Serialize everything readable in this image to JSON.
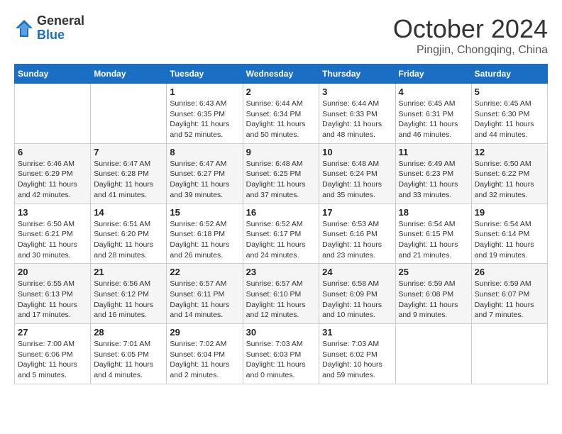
{
  "header": {
    "logo_general": "General",
    "logo_blue": "Blue",
    "month_title": "October 2024",
    "location": "Pingjin, Chongqing, China"
  },
  "weekdays": [
    "Sunday",
    "Monday",
    "Tuesday",
    "Wednesday",
    "Thursday",
    "Friday",
    "Saturday"
  ],
  "weeks": [
    [
      {
        "day": "",
        "info": ""
      },
      {
        "day": "",
        "info": ""
      },
      {
        "day": "1",
        "info": "Sunrise: 6:43 AM\nSunset: 6:35 PM\nDaylight: 11 hours and 52 minutes."
      },
      {
        "day": "2",
        "info": "Sunrise: 6:44 AM\nSunset: 6:34 PM\nDaylight: 11 hours and 50 minutes."
      },
      {
        "day": "3",
        "info": "Sunrise: 6:44 AM\nSunset: 6:33 PM\nDaylight: 11 hours and 48 minutes."
      },
      {
        "day": "4",
        "info": "Sunrise: 6:45 AM\nSunset: 6:31 PM\nDaylight: 11 hours and 46 minutes."
      },
      {
        "day": "5",
        "info": "Sunrise: 6:45 AM\nSunset: 6:30 PM\nDaylight: 11 hours and 44 minutes."
      }
    ],
    [
      {
        "day": "6",
        "info": "Sunrise: 6:46 AM\nSunset: 6:29 PM\nDaylight: 11 hours and 42 minutes."
      },
      {
        "day": "7",
        "info": "Sunrise: 6:47 AM\nSunset: 6:28 PM\nDaylight: 11 hours and 41 minutes."
      },
      {
        "day": "8",
        "info": "Sunrise: 6:47 AM\nSunset: 6:27 PM\nDaylight: 11 hours and 39 minutes."
      },
      {
        "day": "9",
        "info": "Sunrise: 6:48 AM\nSunset: 6:25 PM\nDaylight: 11 hours and 37 minutes."
      },
      {
        "day": "10",
        "info": "Sunrise: 6:48 AM\nSunset: 6:24 PM\nDaylight: 11 hours and 35 minutes."
      },
      {
        "day": "11",
        "info": "Sunrise: 6:49 AM\nSunset: 6:23 PM\nDaylight: 11 hours and 33 minutes."
      },
      {
        "day": "12",
        "info": "Sunrise: 6:50 AM\nSunset: 6:22 PM\nDaylight: 11 hours and 32 minutes."
      }
    ],
    [
      {
        "day": "13",
        "info": "Sunrise: 6:50 AM\nSunset: 6:21 PM\nDaylight: 11 hours and 30 minutes."
      },
      {
        "day": "14",
        "info": "Sunrise: 6:51 AM\nSunset: 6:20 PM\nDaylight: 11 hours and 28 minutes."
      },
      {
        "day": "15",
        "info": "Sunrise: 6:52 AM\nSunset: 6:18 PM\nDaylight: 11 hours and 26 minutes."
      },
      {
        "day": "16",
        "info": "Sunrise: 6:52 AM\nSunset: 6:17 PM\nDaylight: 11 hours and 24 minutes."
      },
      {
        "day": "17",
        "info": "Sunrise: 6:53 AM\nSunset: 6:16 PM\nDaylight: 11 hours and 23 minutes."
      },
      {
        "day": "18",
        "info": "Sunrise: 6:54 AM\nSunset: 6:15 PM\nDaylight: 11 hours and 21 minutes."
      },
      {
        "day": "19",
        "info": "Sunrise: 6:54 AM\nSunset: 6:14 PM\nDaylight: 11 hours and 19 minutes."
      }
    ],
    [
      {
        "day": "20",
        "info": "Sunrise: 6:55 AM\nSunset: 6:13 PM\nDaylight: 11 hours and 17 minutes."
      },
      {
        "day": "21",
        "info": "Sunrise: 6:56 AM\nSunset: 6:12 PM\nDaylight: 11 hours and 16 minutes."
      },
      {
        "day": "22",
        "info": "Sunrise: 6:57 AM\nSunset: 6:11 PM\nDaylight: 11 hours and 14 minutes."
      },
      {
        "day": "23",
        "info": "Sunrise: 6:57 AM\nSunset: 6:10 PM\nDaylight: 11 hours and 12 minutes."
      },
      {
        "day": "24",
        "info": "Sunrise: 6:58 AM\nSunset: 6:09 PM\nDaylight: 11 hours and 10 minutes."
      },
      {
        "day": "25",
        "info": "Sunrise: 6:59 AM\nSunset: 6:08 PM\nDaylight: 11 hours and 9 minutes."
      },
      {
        "day": "26",
        "info": "Sunrise: 6:59 AM\nSunset: 6:07 PM\nDaylight: 11 hours and 7 minutes."
      }
    ],
    [
      {
        "day": "27",
        "info": "Sunrise: 7:00 AM\nSunset: 6:06 PM\nDaylight: 11 hours and 5 minutes."
      },
      {
        "day": "28",
        "info": "Sunrise: 7:01 AM\nSunset: 6:05 PM\nDaylight: 11 hours and 4 minutes."
      },
      {
        "day": "29",
        "info": "Sunrise: 7:02 AM\nSunset: 6:04 PM\nDaylight: 11 hours and 2 minutes."
      },
      {
        "day": "30",
        "info": "Sunrise: 7:03 AM\nSunset: 6:03 PM\nDaylight: 11 hours and 0 minutes."
      },
      {
        "day": "31",
        "info": "Sunrise: 7:03 AM\nSunset: 6:02 PM\nDaylight: 10 hours and 59 minutes."
      },
      {
        "day": "",
        "info": ""
      },
      {
        "day": "",
        "info": ""
      }
    ]
  ]
}
